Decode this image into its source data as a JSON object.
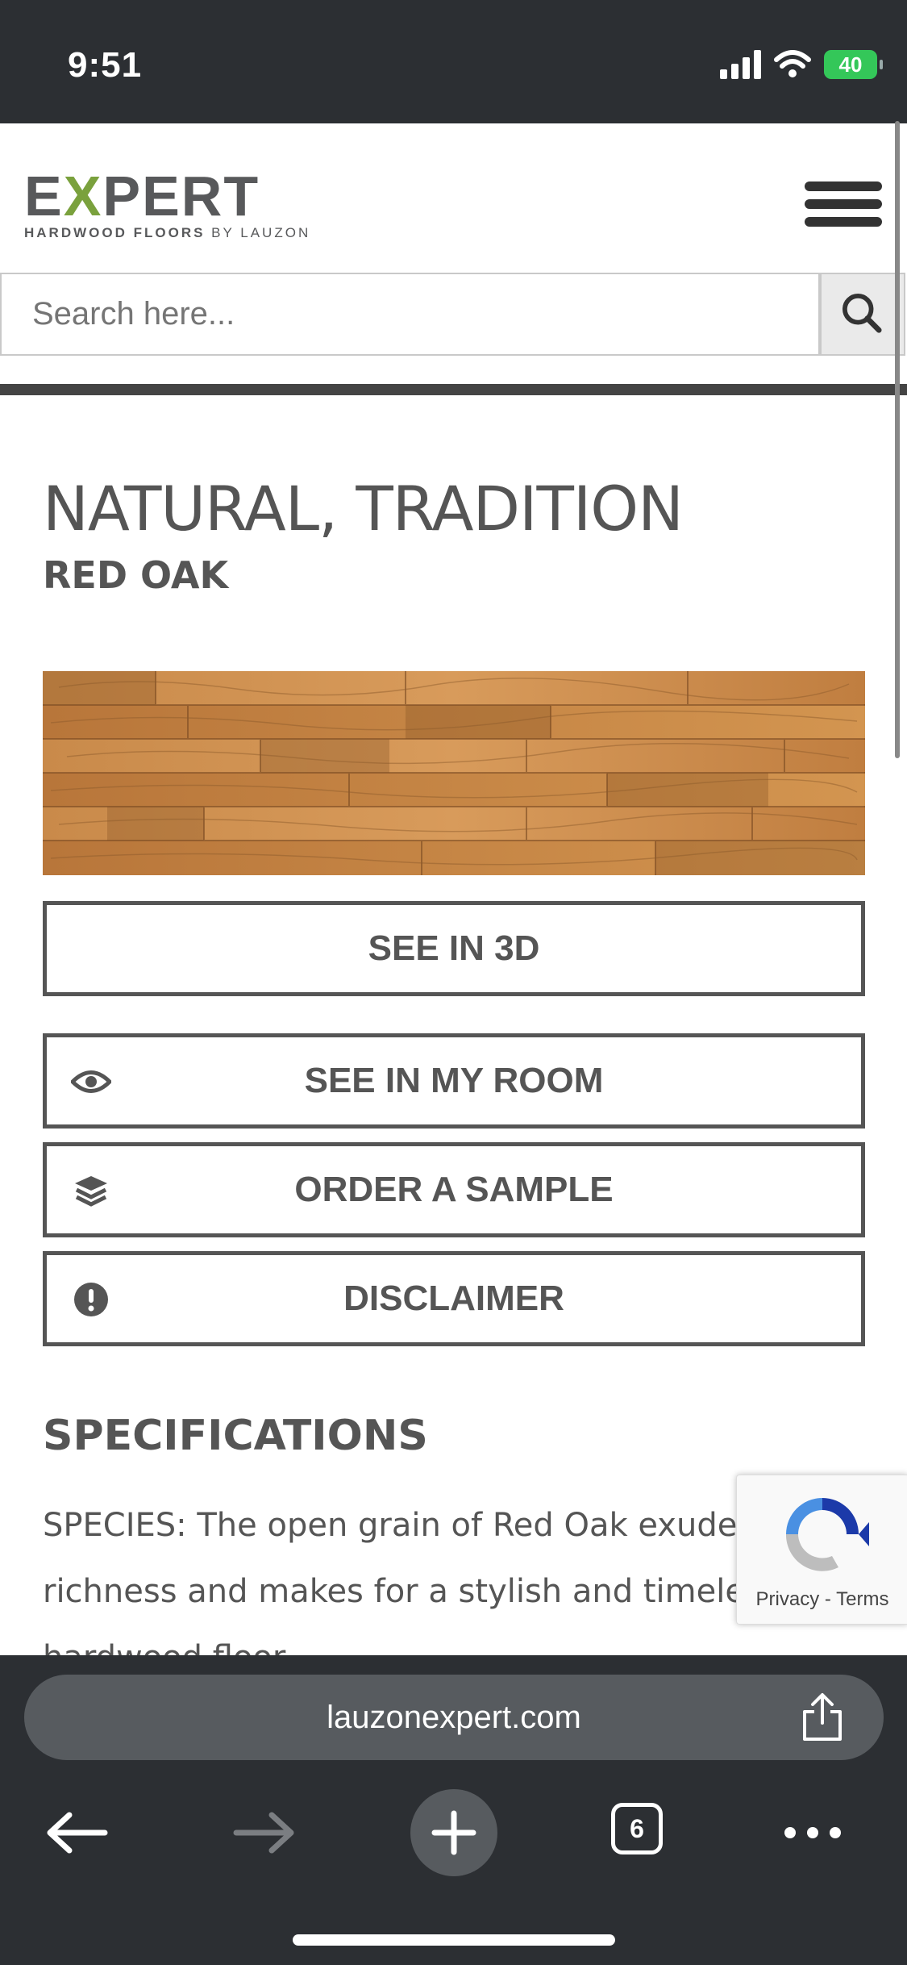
{
  "status": {
    "time": "9:51",
    "battery": "40"
  },
  "logo": {
    "name_pre": "E",
    "name_x": "X",
    "name_post": "PERT",
    "tag_main": "HARDWOOD FLOORS",
    "tag_by": "BY LAUZON"
  },
  "search": {
    "placeholder": "Search here..."
  },
  "product": {
    "title": "NATURAL, TRADITION",
    "species": "RED OAK"
  },
  "buttons": {
    "see3d": "SEE IN 3D",
    "see_room": "SEE IN MY ROOM",
    "order_sample": "ORDER A SAMPLE",
    "disclaimer": "DISCLAIMER"
  },
  "specs": {
    "heading": "SPECIFICATIONS",
    "species_text": "SPECIES: The open grain of Red Oak exudes richness and makes for a stylish and timeless hardwood floor."
  },
  "recaptcha": {
    "label": "Privacy - Terms"
  },
  "browser": {
    "url": "lauzonexpert.com",
    "tab_count": "6"
  },
  "icons": [
    "signal-icon",
    "wifi-icon",
    "battery-icon",
    "menu-icon",
    "search-icon",
    "eye-icon",
    "layers-icon",
    "alert-icon",
    "recaptcha-icon",
    "share-icon",
    "back-arrow-icon",
    "forward-arrow-icon",
    "new-tab-icon",
    "tabs-icon",
    "more-icon"
  ],
  "colors": {
    "brand_gray": "#58595b",
    "brand_green": "#7aa13d",
    "chrome_dark": "#2c2f33",
    "battery_green": "#34c759"
  }
}
